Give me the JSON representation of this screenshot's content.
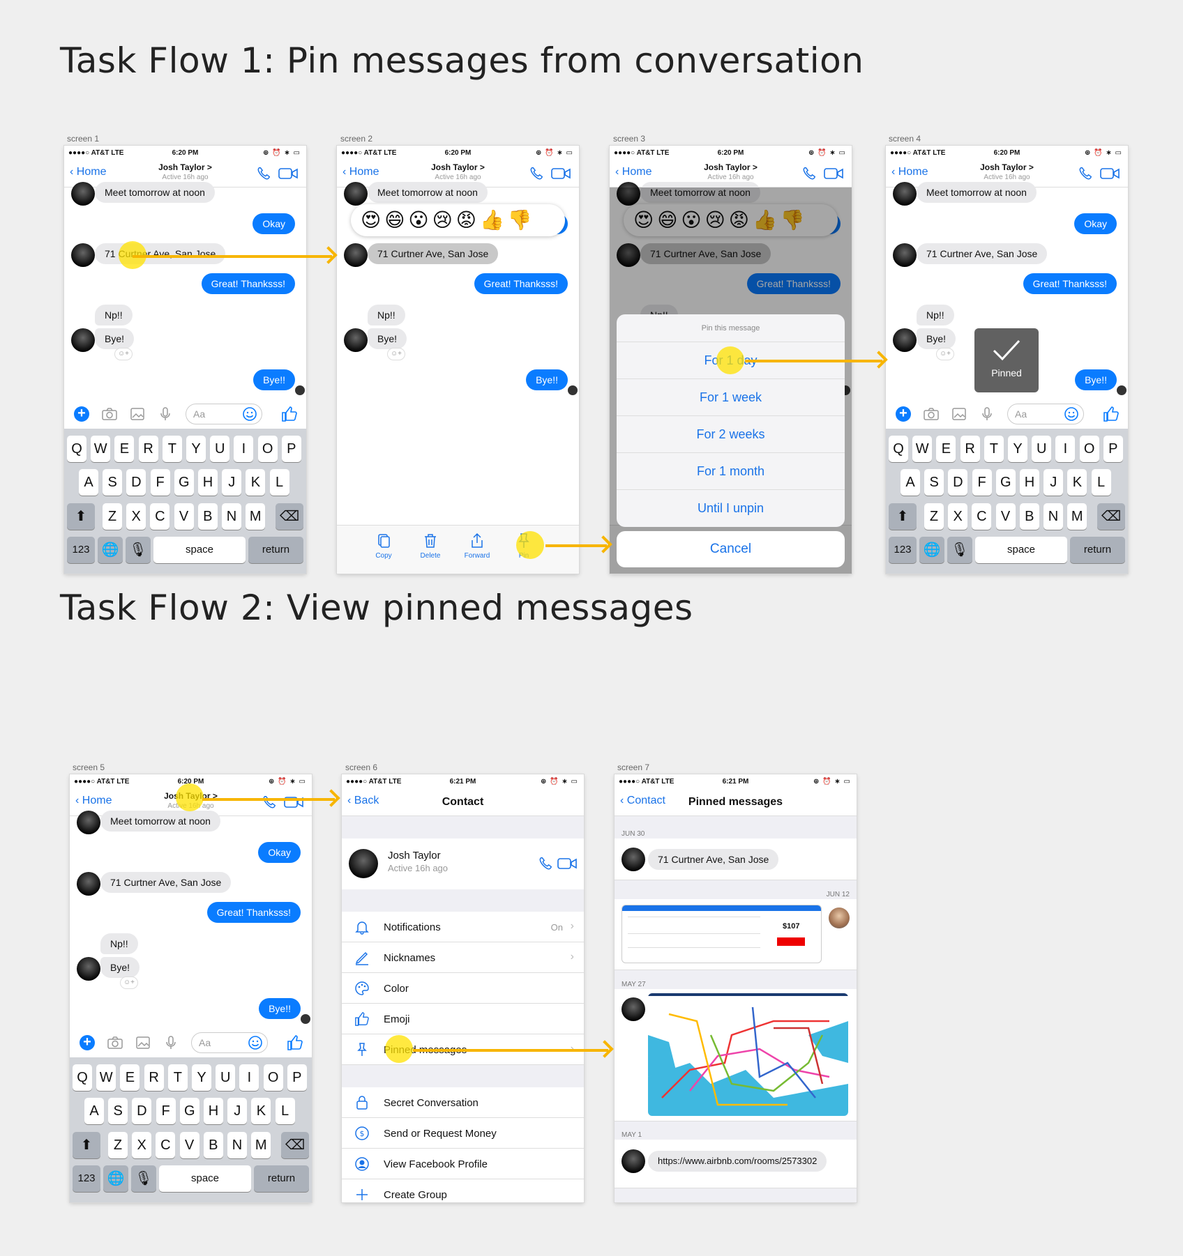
{
  "flow1_title": "Task Flow 1: Pin messages from conversation",
  "flow2_title": "Task Flow 2: View pinned messages",
  "screens": [
    "screen 1",
    "screen 2",
    "screen 3",
    "screen 4",
    "screen 5",
    "screen 6",
    "screen 7"
  ],
  "status": {
    "carrier": "●●●●○ AT&T  LTE",
    "time_a": "6:20 PM",
    "time_b": "6:21 PM",
    "right": "⊕ ⏰ ∗ ▭"
  },
  "chat": {
    "back": "Home",
    "name": "Josh Taylor >",
    "sub": "Active 16h ago",
    "messages": {
      "m1": "Meet tomorrow at noon",
      "m2": "Okay",
      "m3": "71 Curtner Ave, San Jose",
      "m4": "Great! Thanksss!",
      "m5": "Np!!",
      "m6": "Bye!",
      "m7": "Bye!!"
    },
    "composer_placeholder": "Aa"
  },
  "keyboard": {
    "row1": [
      "Q",
      "W",
      "E",
      "R",
      "T",
      "Y",
      "U",
      "I",
      "O",
      "P"
    ],
    "row2": [
      "A",
      "S",
      "D",
      "F",
      "G",
      "H",
      "J",
      "K",
      "L"
    ],
    "row3": [
      "Z",
      "X",
      "C",
      "V",
      "B",
      "N",
      "M"
    ],
    "num": "123",
    "space": "space",
    "return": "return"
  },
  "reactions": "😍😄😮😢😡👍👎",
  "actions": {
    "copy": "Copy",
    "delete": "Delete",
    "forward": "Forward",
    "pin": "Pin"
  },
  "pin_sheet": {
    "title": "Pin this message",
    "options": [
      "For 1 day",
      "For 1 week",
      "For 2 weeks",
      "For 1 month",
      "Until I unpin"
    ],
    "cancel": "Cancel"
  },
  "toast": "Pinned",
  "contact": {
    "back": "Back",
    "title": "Contact",
    "name": "Josh Taylor",
    "sub": "Active 16h ago",
    "rows": [
      "Notifications",
      "Nicknames",
      "Color",
      "Emoji",
      "Pinned messages"
    ],
    "notif_value": "On",
    "rows2": [
      "Secret Conversation",
      "Send or Request Money",
      "View Facebook Profile",
      "Create Group"
    ]
  },
  "pinned": {
    "back": "Contact",
    "title": "Pinned  messages",
    "d1": "JUN 30",
    "msg1": "71 Curtner Ave, San Jose",
    "d2": "JUN 12",
    "flight_price": "$107",
    "d3": "MAY 27",
    "d4": "MAY 1",
    "link": "https://www.airbnb.com/rooms/2573302"
  },
  "colors": {
    "accent": "#0a7cff",
    "link": "#1a73e8",
    "highlight": "#ffe100",
    "arrow": "#f7b500"
  }
}
